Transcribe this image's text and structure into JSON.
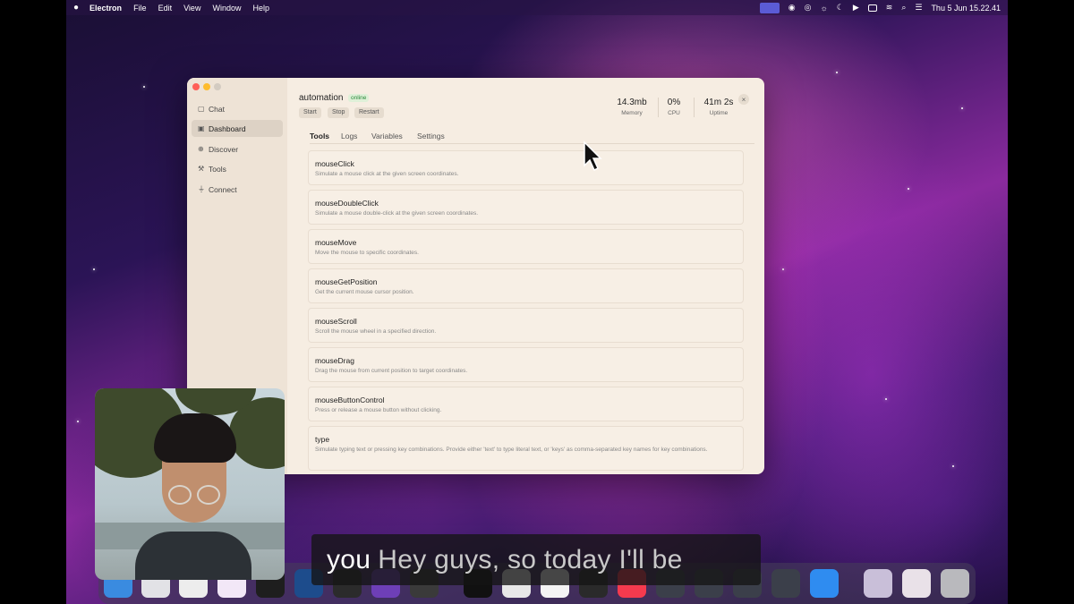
{
  "menubar": {
    "app_name": "Electron",
    "menus": [
      "File",
      "Edit",
      "View",
      "Window",
      "Help"
    ],
    "clock": "Thu 5 Jun  15.22.41"
  },
  "sidebar": {
    "items": [
      {
        "label": "Chat",
        "icon": "chat-bubble-icon"
      },
      {
        "label": "Dashboard",
        "icon": "dashboard-icon",
        "active": true
      },
      {
        "label": "Discover",
        "icon": "globe-icon"
      },
      {
        "label": "Tools",
        "icon": "wrench-icon"
      },
      {
        "label": "Connect",
        "icon": "plug-icon"
      }
    ]
  },
  "header": {
    "title": "automation",
    "status": "online",
    "buttons": {
      "start": "Start",
      "stop": "Stop",
      "restart": "Restart"
    },
    "stats": {
      "memory_value": "14.3mb",
      "memory_label": "Memory",
      "cpu_value": "0%",
      "cpu_label": "CPU",
      "uptime_value": "41m 2s",
      "uptime_label": "Uptime"
    },
    "close": "×"
  },
  "tabs": [
    "Tools",
    "Logs",
    "Variables",
    "Settings"
  ],
  "tools": [
    {
      "name": "mouseClick",
      "description": "Simulate a mouse click at the given screen coordinates."
    },
    {
      "name": "mouseDoubleClick",
      "description": "Simulate a mouse double-click at the given screen coordinates."
    },
    {
      "name": "mouseMove",
      "description": "Move the mouse to specific coordinates."
    },
    {
      "name": "mouseGetPosition",
      "description": "Get the current mouse cursor position."
    },
    {
      "name": "mouseScroll",
      "description": "Scroll the mouse wheel in a specified direction."
    },
    {
      "name": "mouseDrag",
      "description": "Drag the mouse from current position to target coordinates."
    },
    {
      "name": "mouseButtonControl",
      "description": "Press or release a mouse button without clicking."
    },
    {
      "name": "type",
      "description": "Simulate typing text or pressing key combinations. Provide either 'text' to type literal text, or 'keys' as comma-separated key names for key combinations."
    }
  ],
  "caption": {
    "highlight": "you",
    "rest": "Hey guys, so today I'll be"
  }
}
